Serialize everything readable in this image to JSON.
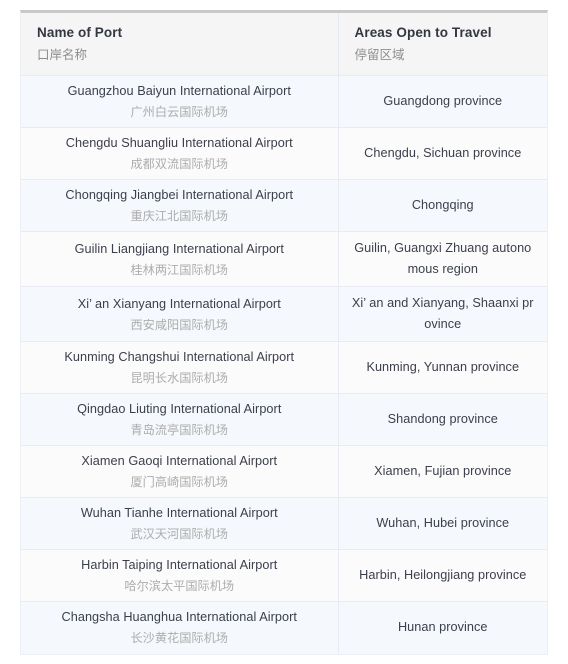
{
  "table": {
    "columns": [
      {
        "en": "Name of Port",
        "cn": "口岸名称"
      },
      {
        "en": "Areas Open to Travel",
        "cn": "停留区域"
      }
    ],
    "rows": [
      {
        "port_en": "Guangzhou Baiyun International Airport",
        "port_cn": "广州白云国际机场",
        "area": "Guangdong province"
      },
      {
        "port_en": "Chengdu Shuangliu International Airport",
        "port_cn": "成都双流国际机场",
        "area": "Chengdu, Sichuan province"
      },
      {
        "port_en": "Chongqing Jiangbei International Airport",
        "port_cn": "重庆江北国际机场",
        "area": "Chongqing"
      },
      {
        "port_en": "Guilin Liangjiang International Airport",
        "port_cn": "桂林两江国际机场",
        "area": "Guilin, Guangxi Zhuang autono mous region"
      },
      {
        "port_en": "Xi’ an Xianyang International Airport",
        "port_cn": "西安咸阳国际机场",
        "area": "Xi’ an and Xianyang, Shaanxi pr ovince"
      },
      {
        "port_en": "Kunming Changshui International Airport",
        "port_cn": "昆明长水国际机场",
        "area": "Kunming, Yunnan province"
      },
      {
        "port_en": "Qingdao Liuting International Airport",
        "port_cn": "青岛流亭国际机场",
        "area": "Shandong province"
      },
      {
        "port_en": "Xiamen Gaoqi International Airport",
        "port_cn": "厦门高崎国际机场",
        "area": "Xiamen, Fujian province"
      },
      {
        "port_en": "Wuhan Tianhe International Airport",
        "port_cn": "武汉天河国际机场",
        "area": "Wuhan, Hubei province"
      },
      {
        "port_en": "Harbin Taiping International Airport",
        "port_cn": "哈尔滨太平国际机场",
        "area": "Harbin, Heilongjiang province"
      },
      {
        "port_en": "Changsha Huanghua International Airport",
        "port_cn": "长沙黄花国际机场",
        "area": "Hunan province"
      }
    ]
  },
  "colors": {
    "header_bg": "#f5f5f5",
    "row_odd_bg": "#f5f8fc",
    "row_even_bg": "#fbfbfc",
    "border": "#e8ecf2",
    "top_rule": "#c9c9c9",
    "text_primary": "#3b3f4a",
    "text_secondary": "#adadad"
  }
}
